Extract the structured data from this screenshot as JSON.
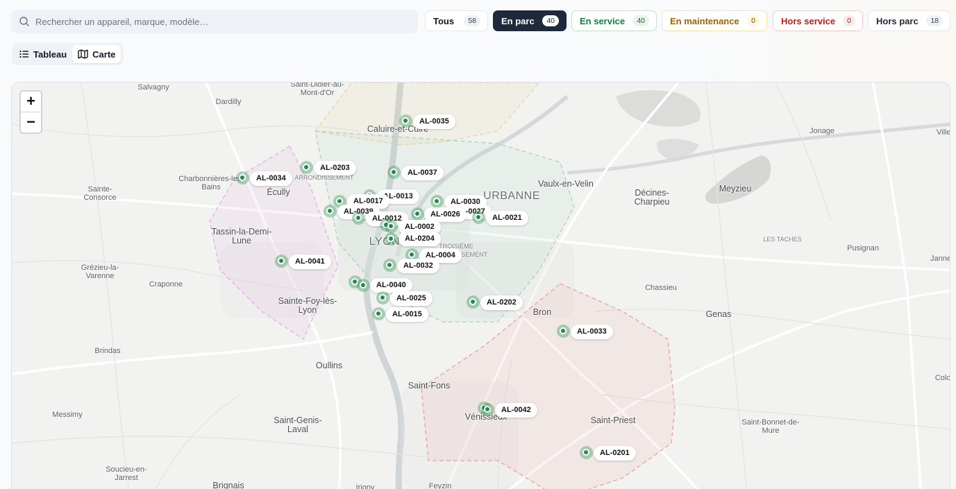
{
  "search": {
    "placeholder": "Rechercher un appareil, marque, modèle…",
    "icon": "search-icon"
  },
  "filters": [
    {
      "label": "Tous",
      "count": "58"
    },
    {
      "label": "En parc",
      "count": "40"
    },
    {
      "label": "En service",
      "count": "40"
    },
    {
      "label": "En maintenance",
      "count": "0"
    },
    {
      "label": "Hors service",
      "count": "0"
    },
    {
      "label": "Hors parc",
      "count": "18"
    }
  ],
  "view": {
    "table_label": "Tableau",
    "map_label": "Carte",
    "active": "Carte"
  },
  "map": {
    "zoom_in": "+",
    "zoom_out": "−",
    "marker_color": "#1f8a4a",
    "places": [
      "Salvagny",
      "Saint-Didier-au-Mont-d'Or",
      "Dardilly",
      "Caluire-et-Cuire",
      "Jonage",
      "Charbonnières-les-Bains",
      "ARRONDISSEMENT",
      "Écully",
      "Vaulx-en-Velin",
      "URBANNE",
      "Meyzieu",
      "Sainte-Consorce",
      "Décines-Charpieu",
      "Tassin-la-Demi-Lune",
      "LYON",
      "TROISIÈME ARRONDISSEMENT",
      "LES TACHES",
      "Pusignan",
      "Grézieu-la-Varenne",
      "Craponne",
      "Chassieu",
      "Sainte-Foy-lès-Lyon",
      "Bron",
      "Genas",
      "Brindas",
      "Oullins",
      "Saint-Fons",
      "Messimy",
      "Vénissieux",
      "Saint-Priest",
      "Saint-Genis-Laval",
      "Saint-Bonnet-de-Mure",
      "Soucieu-en-Jarrest",
      "Brignais",
      "Feyzin",
      "Irigny",
      "Janne",
      "Villette-d'Anthon",
      "Colo"
    ],
    "markers": [
      "AL-0035",
      "AL-0203",
      "AL-0034",
      "AL-0037",
      "AL-0013",
      "AL-0017",
      "AL-0030",
      "AL-0039",
      "AL-0027",
      "AL-0026",
      "AL-0012",
      "AL-0021",
      "AL-0002",
      "AL-0204",
      "AL-0004",
      "AL-0041",
      "AL-0032",
      "AL-0040",
      "AL-0025",
      "AL-0202",
      "AL-0015",
      "AL-0033",
      "AL-0042",
      "AL-0201"
    ]
  }
}
